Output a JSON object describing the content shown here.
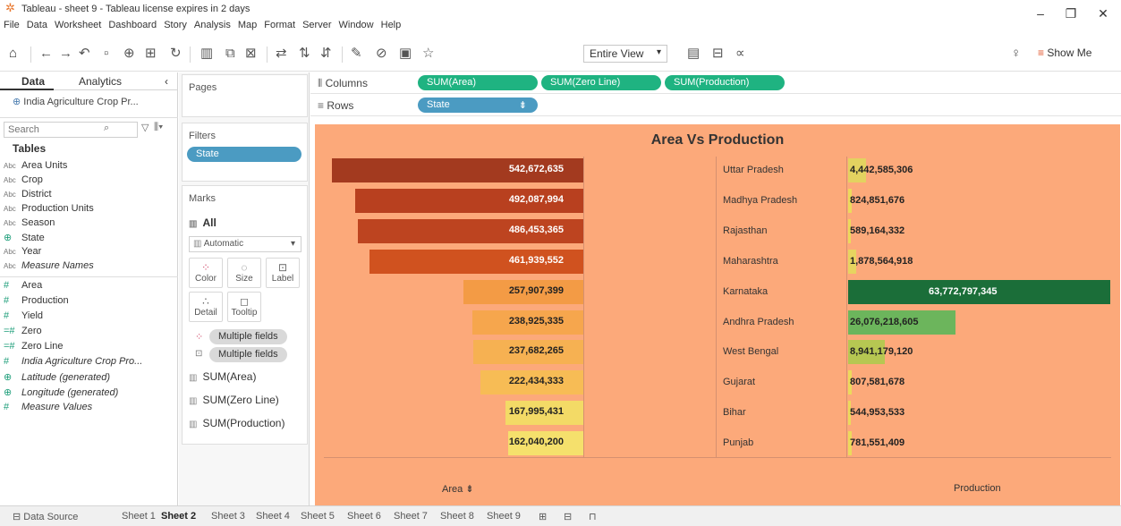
{
  "window": {
    "title": "Tableau - sheet 9 - Tableau license expires in 2 days",
    "controls": [
      "minimize-icon",
      "restore-icon",
      "close-icon"
    ]
  },
  "menu": [
    "File",
    "Data",
    "Worksheet",
    "Dashboard",
    "Story",
    "Analysis",
    "Map",
    "Format",
    "Server",
    "Window",
    "Help"
  ],
  "toolbar": {
    "view_select": "Entire View",
    "show_me": "Show Me"
  },
  "data_pane": {
    "tabs": [
      "Data",
      "Analytics"
    ],
    "datasource": "India Agriculture Crop Pr...",
    "search_placeholder": "Search",
    "tables_header": "Tables",
    "dimensions": [
      {
        "type": "Abc",
        "name": "Area Units"
      },
      {
        "type": "Abc",
        "name": "Crop"
      },
      {
        "type": "Abc",
        "name": "District"
      },
      {
        "type": "Abc",
        "name": "Production Units"
      },
      {
        "type": "Abc",
        "name": "Season"
      },
      {
        "type": "globe",
        "name": "State"
      },
      {
        "type": "Abc",
        "name": "Year"
      },
      {
        "type": "Abc",
        "name": "Measure Names"
      }
    ],
    "measures": [
      {
        "type": "#",
        "name": "Area"
      },
      {
        "type": "#",
        "name": "Production"
      },
      {
        "type": "#",
        "name": "Yield"
      },
      {
        "type": "=#",
        "name": "Zero"
      },
      {
        "type": "=#",
        "name": "Zero Line"
      },
      {
        "type": "#",
        "name": "India Agriculture Crop Pro..."
      },
      {
        "type": "globe",
        "name": "Latitude (generated)"
      },
      {
        "type": "globe",
        "name": "Longitude (generated)"
      },
      {
        "type": "#",
        "name": "Measure Values"
      }
    ]
  },
  "cards": {
    "pages": "Pages",
    "filters": "Filters",
    "filter_pill": "State",
    "marks": "Marks",
    "marks_all": "All",
    "mark_type": "Automatic",
    "mark_buttons": [
      "Color",
      "Size",
      "Label",
      "Detail",
      "Tooltip"
    ],
    "multiple_fields_1": "Multiple fields",
    "multiple_fields_2": "Multiple fields",
    "mark_layers": [
      "SUM(Area)",
      "SUM(Zero Line)",
      "SUM(Production)"
    ]
  },
  "shelves": {
    "columns_label": "Columns",
    "columns": [
      "SUM(Area)",
      "SUM(Zero Line)",
      "SUM(Production)"
    ],
    "rows_label": "Rows",
    "rows": [
      "State"
    ]
  },
  "chart_data": {
    "type": "bar",
    "title": "Area Vs Production",
    "categories": [
      "Uttar Pradesh",
      "Madhya Pradesh",
      "Rajasthan",
      "Maharashtra",
      "Karnataka",
      "Andhra Pradesh",
      "West Bengal",
      "Gujarat",
      "Bihar",
      "Punjab"
    ],
    "series": [
      {
        "name": "Area",
        "values": [
          542672635,
          492087994,
          486453365,
          461939552,
          257907399,
          238925335,
          237682265,
          222434333,
          167995431,
          162040200
        ],
        "labels": [
          "542,672,635",
          "492,087,994",
          "486,453,365",
          "461,939,552",
          "257,907,399",
          "238,925,335",
          "237,682,265",
          "222,434,333",
          "167,995,431",
          "162,040,200"
        ],
        "colors": [
          "#a33a1f",
          "#b8401f",
          "#bd4420",
          "#d0521f",
          "#f39b45",
          "#f6a64d",
          "#f6b152",
          "#f7bc55",
          "#f3da66",
          "#f5e06c"
        ]
      },
      {
        "name": "Production",
        "values": [
          4442585306,
          824851676,
          589164332,
          1878564918,
          63772797345,
          26076218605,
          8941179120,
          807581678,
          544953533,
          781551409
        ],
        "labels": [
          "4,442,585,306",
          "824,851,676",
          "589,164,332",
          "1,878,564,918",
          "63,772,797,345",
          "26,076,218,605",
          "8,941,179,120",
          "807,581,678",
          "544,953,533",
          "781,551,409"
        ],
        "colors": [
          "#e3d260",
          "#ecd95c",
          "#ecd95c",
          "#e7d460",
          "#1b6e39",
          "#6cb55c",
          "#b6c752",
          "#ecd95c",
          "#ecd95c",
          "#ecd95c"
        ]
      }
    ],
    "xlabels": [
      "Area",
      "Production"
    ],
    "axis_direction": "area reversed (bars grow right-to-left), production left-to-right",
    "grid": false,
    "background": "#fca97a"
  },
  "sheet_tabs": {
    "datasource": "Data Source",
    "sheets": [
      "Sheet 1",
      "Sheet 2",
      "Sheet 3",
      "Sheet 4",
      "Sheet 5",
      "Sheet 6",
      "Sheet 7",
      "Sheet 8",
      "Sheet 9"
    ],
    "active": "Sheet 2"
  }
}
